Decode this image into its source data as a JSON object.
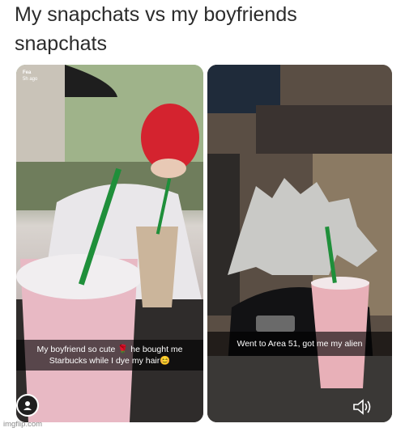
{
  "title": {
    "line1": "My snapchats vs my boyfriends",
    "line2": "snapchats"
  },
  "left_snap": {
    "header_name": "Fea",
    "header_time": "5h ago",
    "caption_line1": "My boyfriend so cute 🌹 he bought me",
    "caption_line2": "Starbucks while I dye my hair😊"
  },
  "right_snap": {
    "caption": "Went to Area 51, got me my alien"
  },
  "icons": {
    "avatar": "ghost-avatar-icon",
    "sound": "speaker-icon"
  },
  "watermark": "imgflip.com"
}
